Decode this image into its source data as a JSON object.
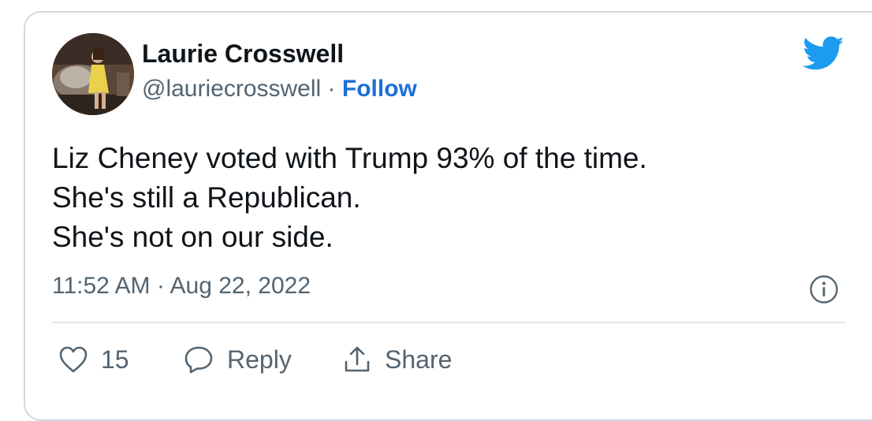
{
  "tweet": {
    "author": {
      "display_name": "Laurie Crosswell",
      "handle": "@lauriecrosswell",
      "separator": "·",
      "follow_label": "Follow",
      "avatar_icon": "avatar-photo"
    },
    "text_lines": [
      "Liz Cheney voted with Trump 93% of the time.",
      "She's still a Republican.",
      "She's not on our side."
    ],
    "timestamp": "11:52 AM · Aug 22, 2022",
    "actions": {
      "like_count": "15",
      "reply_label": "Reply",
      "share_label": "Share"
    },
    "icons": {
      "brand": "twitter-bird-icon",
      "info": "info-icon",
      "like": "heart-icon",
      "reply": "speech-bubble-icon",
      "share": "share-upload-icon"
    },
    "colors": {
      "brand_blue": "#1d9bf0",
      "follow_blue": "#1d6fd6",
      "text_primary": "#0f1419",
      "text_secondary": "#536471",
      "border": "#cfd9de"
    }
  }
}
